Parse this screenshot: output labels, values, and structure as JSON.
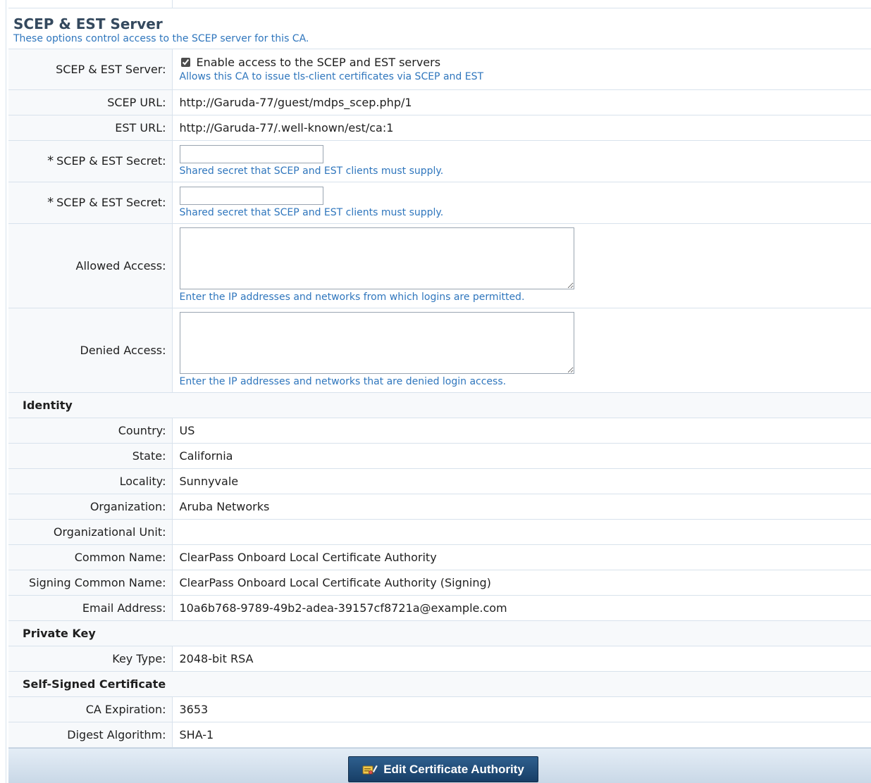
{
  "section": {
    "title": "SCEP & EST Server",
    "description": "These options control access to the SCEP server for this CA."
  },
  "scep": {
    "server_label": "SCEP & EST Server:",
    "enable_checked": true,
    "enable_label": "Enable access to the SCEP and EST servers",
    "enable_help": "Allows this CA to issue tls-client certificates via SCEP and EST",
    "scep_url_label": "SCEP URL:",
    "scep_url": "http://Garuda-77/guest/mdps_scep.php/1",
    "est_url_label": "EST URL:",
    "est_url": "http://Garuda-77/.well-known/est/ca:1",
    "required_mark": "*",
    "secret_label": "SCEP & EST Secret:",
    "secret_value": "",
    "secret_help": "Shared secret that SCEP and EST clients must supply.",
    "secret_confirm_label": "SCEP & EST Secret:",
    "secret_confirm_value": "",
    "secret_confirm_help": "Shared secret that SCEP and EST clients must supply.",
    "allowed_label": "Allowed Access:",
    "allowed_value": "",
    "allowed_help": "Enter the IP addresses and networks from which logins are permitted.",
    "denied_label": "Denied Access:",
    "denied_value": "",
    "denied_help": "Enter the IP addresses and networks that are denied login access."
  },
  "identity": {
    "heading": "Identity",
    "rows": [
      {
        "label": "Country:",
        "value": "US"
      },
      {
        "label": "State:",
        "value": "California"
      },
      {
        "label": "Locality:",
        "value": "Sunnyvale"
      },
      {
        "label": "Organization:",
        "value": "Aruba Networks"
      },
      {
        "label": "Organizational Unit:",
        "value": ""
      },
      {
        "label": "Common Name:",
        "value": "ClearPass Onboard Local Certificate Authority"
      },
      {
        "label": "Signing Common Name:",
        "value": "ClearPass Onboard Local Certificate Authority (Signing)"
      },
      {
        "label": "Email Address:",
        "value": "10a6b768-9789-49b2-adea-39157cf8721a@example.com"
      }
    ]
  },
  "private_key": {
    "heading": "Private Key",
    "key_type_label": "Key Type:",
    "key_type": "2048-bit RSA"
  },
  "certificate": {
    "heading": "Self-Signed Certificate",
    "expiration_label": "CA Expiration:",
    "expiration": "3653",
    "digest_label": "Digest Algorithm:",
    "digest": "SHA-1"
  },
  "footer": {
    "edit_button_label": "Edit Certificate Authority",
    "edit_button_icon": "certificate-edit-icon"
  },
  "colors": {
    "help_text": "#2f76bd",
    "section_title": "#34495e",
    "button": "#1f4a75"
  }
}
